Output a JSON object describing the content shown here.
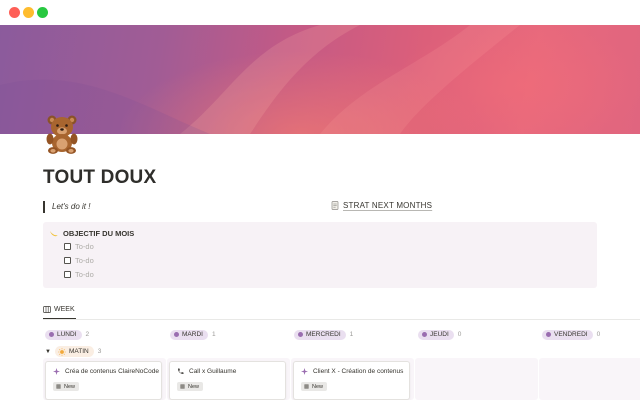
{
  "window": {
    "controls": [
      "close",
      "minimize",
      "zoom"
    ]
  },
  "page": {
    "icon": "teddy-bear-icon",
    "title": "TOUT DOUX",
    "quote": "Let's do it !",
    "strat_link": {
      "icon": "document-icon",
      "label": "STRAT NEXT MONTHS"
    }
  },
  "callout": {
    "icon": "crescent-icon",
    "heading": "OBJECTIF DU MOIS",
    "todos": [
      "To-do",
      "To-do",
      "To-do"
    ]
  },
  "board": {
    "view_tab": {
      "icon": "board-icon",
      "label": "WEEK"
    },
    "columns": [
      {
        "label": "LUNDI",
        "count": "2"
      },
      {
        "label": "MARDI",
        "count": "1"
      },
      {
        "label": "MERCREDI",
        "count": "1"
      },
      {
        "label": "JEUDI",
        "count": "0"
      },
      {
        "label": "VENDREDI",
        "count": "0"
      }
    ],
    "group": {
      "icon": "sun-icon",
      "label": "MATIN",
      "count": "3"
    },
    "cards": [
      {
        "icon": "sparkle-icon",
        "title": "Créa de contenus ClaireNoCode",
        "tag": "New"
      },
      {
        "icon": "phone-icon",
        "title": "Call x Guillaume",
        "tag": "New"
      },
      {
        "icon": "sparkle-icon",
        "title": "Client X - Création de contenus",
        "tag": "New"
      }
    ]
  },
  "colors": {
    "accent_pill": "#eadff0",
    "callout_bg": "#f7f2f6",
    "group_pill": "#faeee3"
  }
}
